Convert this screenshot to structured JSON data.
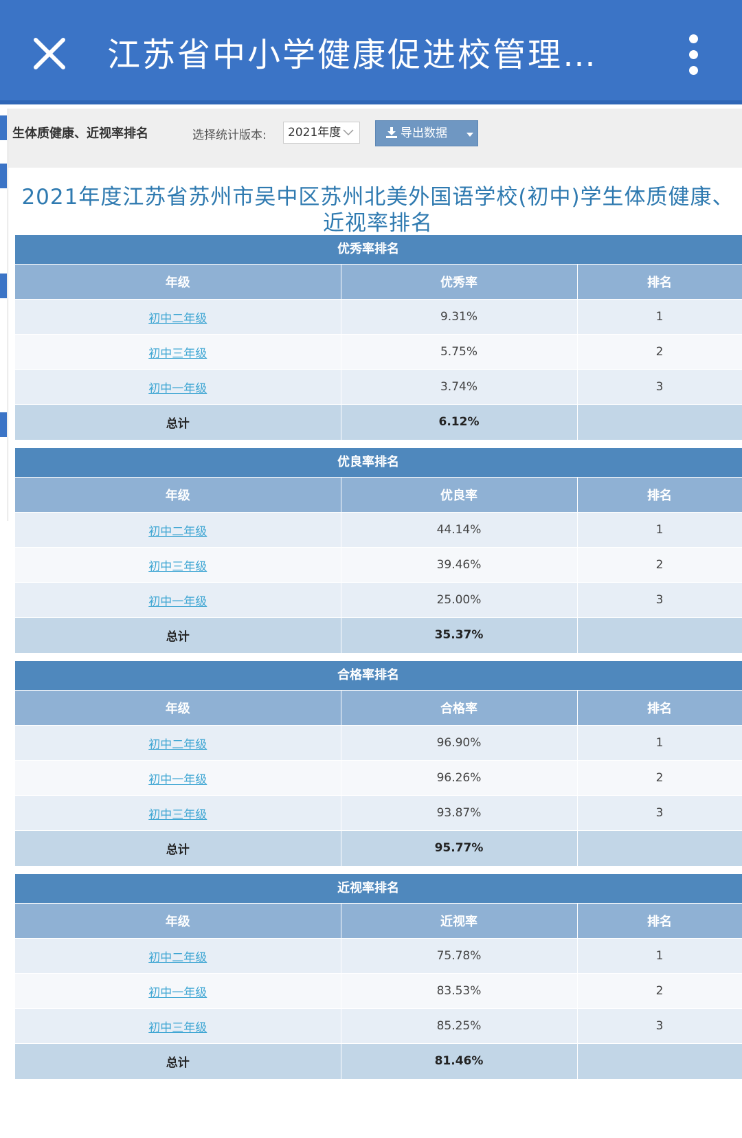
{
  "appbar": {
    "title": "江苏省中小学健康促进校管理…"
  },
  "toolbar": {
    "title": "生体质健康、近视率排名",
    "version_label": "选择统计版本:",
    "version_value": "2021年度",
    "export_label": "导出数据"
  },
  "heading": {
    "line1": "2021年度江苏省苏州市吴中区苏州北美外国语学校(初中)学生体质健康、",
    "line2": "近视率排名"
  },
  "tables": [
    {
      "title": "优秀率排名",
      "headers": [
        "年级",
        "优秀率",
        "排名"
      ],
      "rows": [
        {
          "grade": "初中二年级",
          "rate": "9.31%",
          "rank": "1"
        },
        {
          "grade": "初中三年级",
          "rate": "5.75%",
          "rank": "2"
        },
        {
          "grade": "初中一年级",
          "rate": "3.74%",
          "rank": "3"
        }
      ],
      "total": {
        "label": "总计",
        "rate": "6.12%"
      }
    },
    {
      "title": "优良率排名",
      "headers": [
        "年级",
        "优良率",
        "排名"
      ],
      "rows": [
        {
          "grade": "初中二年级",
          "rate": "44.14%",
          "rank": "1"
        },
        {
          "grade": "初中三年级",
          "rate": "39.46%",
          "rank": "2"
        },
        {
          "grade": "初中一年级",
          "rate": "25.00%",
          "rank": "3"
        }
      ],
      "total": {
        "label": "总计",
        "rate": "35.37%"
      }
    },
    {
      "title": "合格率排名",
      "headers": [
        "年级",
        "合格率",
        "排名"
      ],
      "rows": [
        {
          "grade": "初中二年级",
          "rate": "96.90%",
          "rank": "1"
        },
        {
          "grade": "初中一年级",
          "rate": "96.26%",
          "rank": "2"
        },
        {
          "grade": "初中三年级",
          "rate": "93.87%",
          "rank": "3"
        }
      ],
      "total": {
        "label": "总计",
        "rate": "95.77%"
      }
    },
    {
      "title": "近视率排名",
      "headers": [
        "年级",
        "近视率",
        "排名"
      ],
      "rows": [
        {
          "grade": "初中二年级",
          "rate": "75.78%",
          "rank": "1"
        },
        {
          "grade": "初中一年级",
          "rate": "83.53%",
          "rank": "2"
        },
        {
          "grade": "初中三年级",
          "rate": "85.25%",
          "rank": "3"
        }
      ],
      "total": {
        "label": "总计",
        "rate": "81.46%"
      }
    }
  ]
}
